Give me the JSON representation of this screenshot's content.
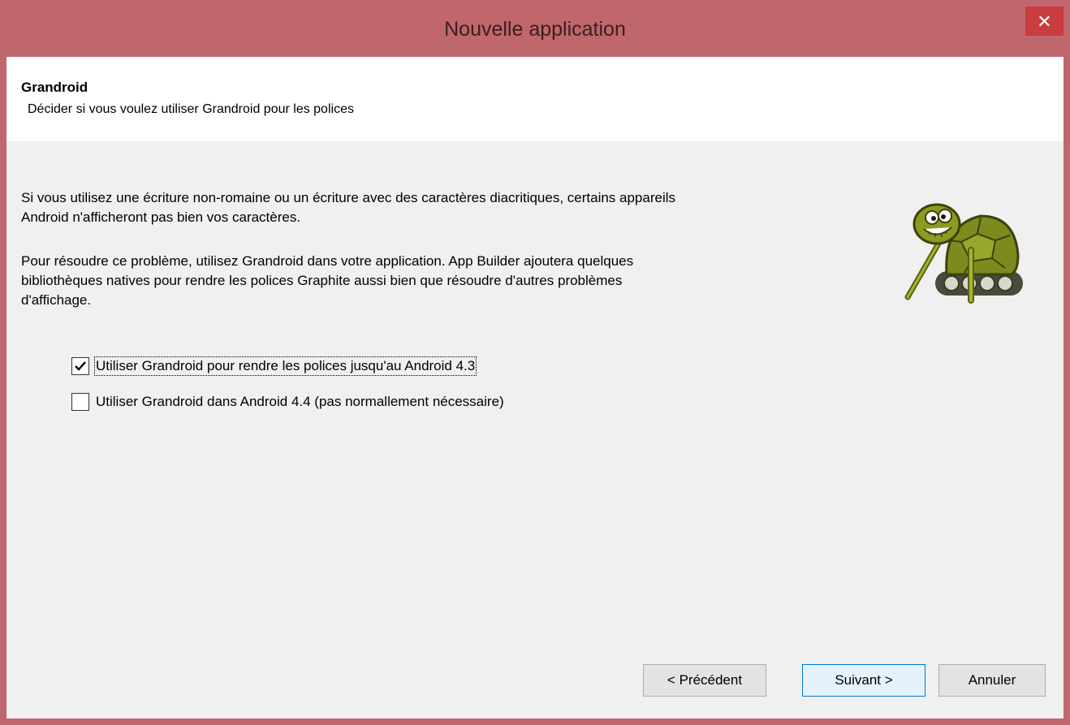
{
  "window": {
    "title": "Nouvelle application",
    "close_glyph": "✕"
  },
  "header": {
    "title": "Grandroid",
    "subtitle": "Décider si vous voulez utiliser Grandroid pour les polices"
  },
  "body": {
    "paragraph_1_line_1": "Si vous utilisez une écriture non-romaine ou un écriture avec des caractères diacritiques, certains appareils",
    "paragraph_1_line_2": "Android n'afficheront pas bien vos caractères.",
    "paragraph_2_line_1": "Pour résoudre ce problème, utilisez Grandroid dans votre application. App Builder ajoutera quelques",
    "paragraph_2_line_2": "bibliothèques natives pour rendre les polices Graphite aussi bien que résoudre d'autres problèmes",
    "paragraph_2_line_3": "d'affichage."
  },
  "options": [
    {
      "label": "Utiliser Grandroid pour rendre les polices jusqu'au Android 4.3",
      "checked": true
    },
    {
      "label": "Utiliser Grandroid dans Android 4.4 (pas normallement nécessaire)",
      "checked": false
    }
  ],
  "buttons": {
    "back": "< Précédent",
    "next": "Suivant >",
    "cancel": "Annuler"
  },
  "icons": {
    "mascot": "turtle-robot-icon",
    "close": "close-icon",
    "check": "checkmark-icon"
  },
  "colors": {
    "titlebar": "#c0666d",
    "close_button": "#c73d40",
    "content_bg": "#f0f0f0",
    "header_bg": "#ffffff",
    "default_button_border": "#0078d7"
  }
}
